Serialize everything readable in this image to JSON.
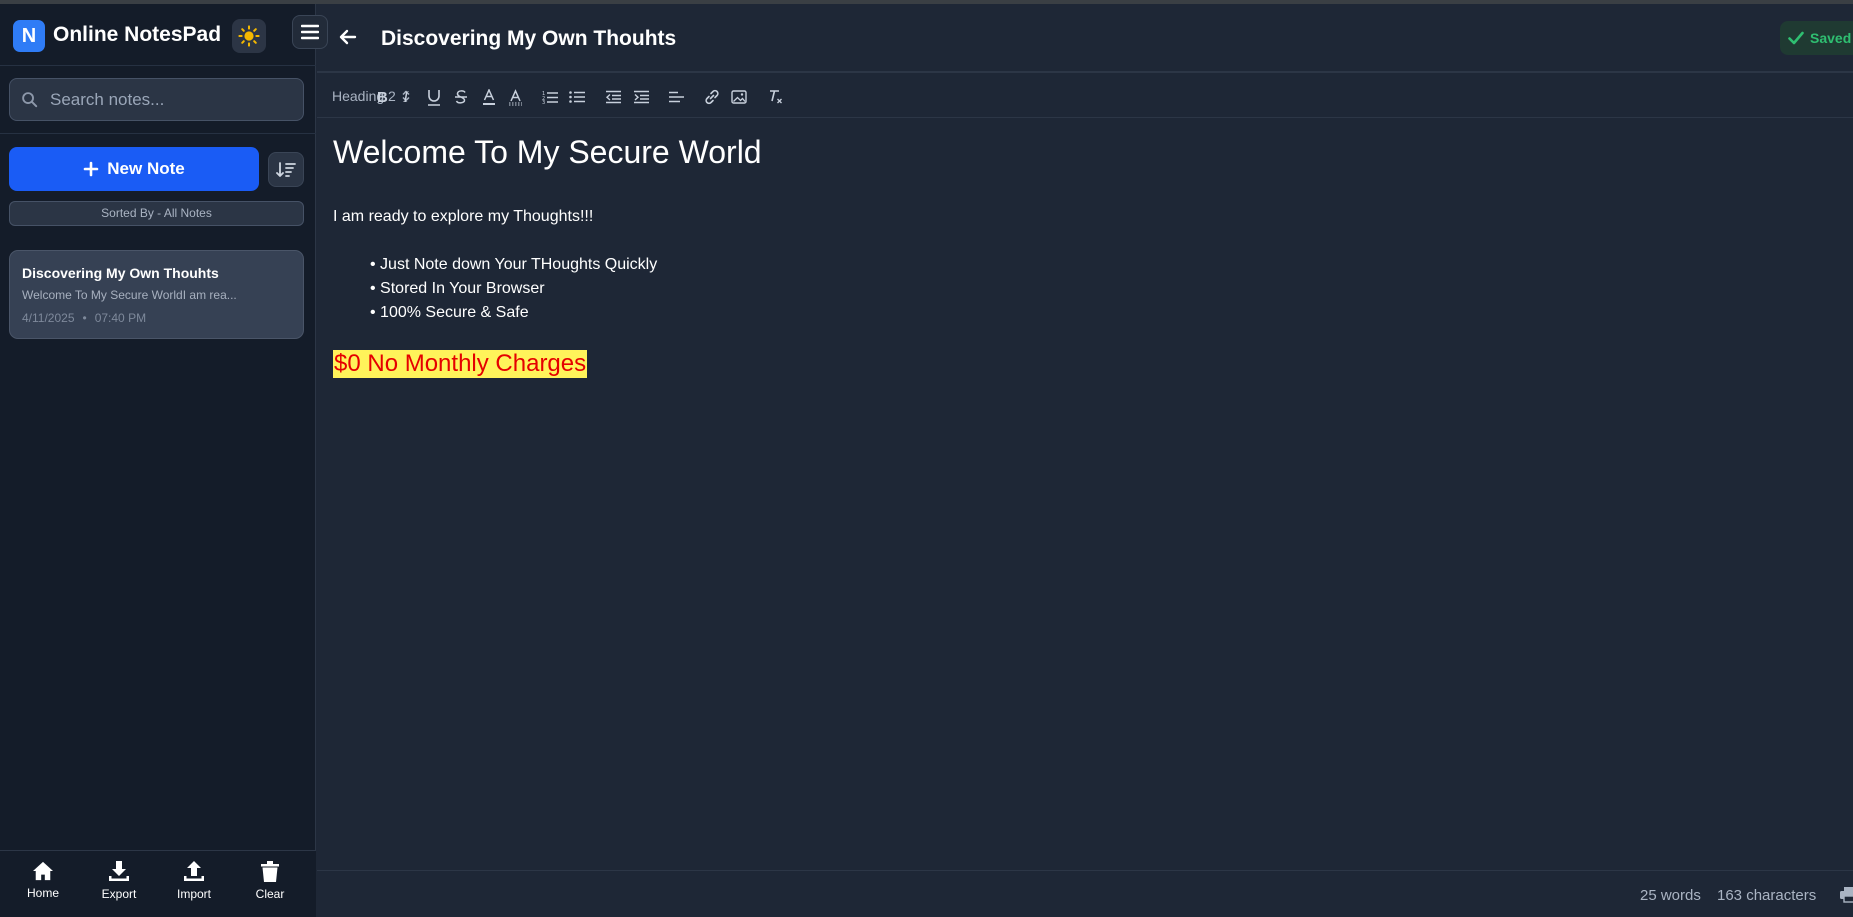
{
  "app": {
    "logo_letter": "N",
    "name": "Online NotesPad",
    "accent_color": "#1a5cf5",
    "theme_icon": "sun-icon",
    "menu_icon": "hamburger-icon"
  },
  "sidebar": {
    "search": {
      "placeholder": "Search notes...",
      "value": ""
    },
    "new_note_label": "New Note",
    "sort_icon": "sort-icon",
    "sorted_by": "Sorted By - All Notes",
    "notes": [
      {
        "title": "Discovering My Own Thouhts",
        "preview": "Welcome To My Secure WorldI am rea...",
        "date": "4/11/2025",
        "separator": "•",
        "time": "07:40 PM"
      }
    ],
    "bottom_nav": [
      {
        "label": "Home",
        "icon": "home-icon"
      },
      {
        "label": "Export",
        "icon": "download-icon"
      },
      {
        "label": "Import",
        "icon": "upload-icon"
      },
      {
        "label": "Clear",
        "icon": "trash-icon"
      }
    ]
  },
  "editor_header": {
    "title": "Discovering My Own Thouhts",
    "saved_label": "Saved",
    "saved_color": "#2fbf71"
  },
  "toolbar": {
    "block_format": "Heading 2",
    "buttons": [
      "bold",
      "italic",
      "underline",
      "strikethrough",
      "text-color",
      "highlight-color",
      "ordered-list",
      "bullet-list",
      "outdent",
      "indent",
      "align-left",
      "link",
      "image",
      "clear-format"
    ]
  },
  "document": {
    "heading": "Welcome To My Secure World",
    "paragraph": "I am ready to explore my Thoughts!!!",
    "bullets": [
      "• Just Note down Your THoughts Quickly",
      "• Stored In Your Browser",
      "• 100% Secure & Safe"
    ],
    "highlight": "$0 No Monthly Charges",
    "highlight_text_color": "#e50000",
    "highlight_bg_color": "#fff35a"
  },
  "status": {
    "words": "25 words",
    "characters": "163 characters"
  }
}
